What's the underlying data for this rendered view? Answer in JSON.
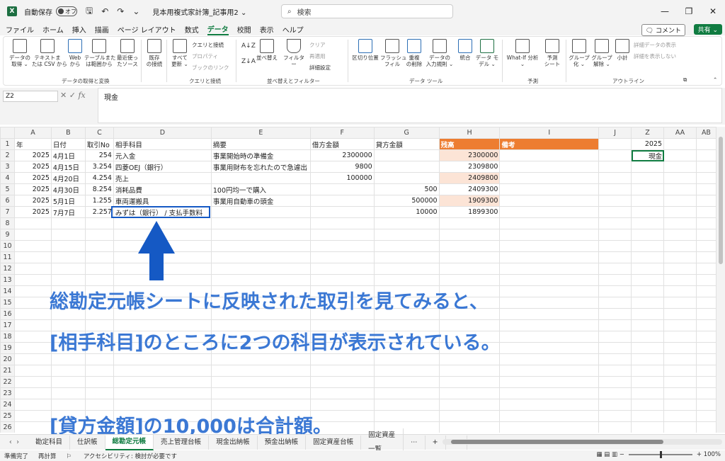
{
  "titlebar": {
    "autosave_label": "自動保存",
    "autosave_state": "オフ",
    "filename": "見本用複式家計簿_記事用2 ⌄",
    "search_placeholder": "検索"
  },
  "menu": {
    "items": [
      "ファイル",
      "ホーム",
      "挿入",
      "描画",
      "ページ レイアウト",
      "数式",
      "データ",
      "校閲",
      "表示",
      "ヘルプ"
    ],
    "active": "データ",
    "comment_label": "コメント",
    "share_label": "共有 ⌄"
  },
  "ribbon": {
    "groups": [
      {
        "name": "データの取得と変換"
      },
      {
        "name": "クエリと接続"
      },
      {
        "name": "並べ替えとフィルター"
      },
      {
        "name": "データ ツール"
      },
      {
        "name": "予測"
      },
      {
        "name": "アウトライン"
      }
    ],
    "buttons": {
      "get_data": "データの\n取得 ⌄",
      "from_text": "テキストま\nたは CSV から",
      "from_web": "Web\nから",
      "from_table": "テーブルまた\nは範囲から",
      "recent": "最近使っ\nたソース",
      "existing": "既存\nの接続",
      "refresh": "すべて\n更新 ⌄",
      "queries": "クエリと接続",
      "properties": "プロパティ",
      "workbook_links": "ブックのリンク",
      "sort": "並べ替え",
      "filter": "フィルター",
      "clear": "クリア",
      "reapply": "再適用",
      "advanced": "詳細設定",
      "text_to_columns": "区切り位置",
      "flash_fill": "フラッシュ\nフィル",
      "remove_dup": "重複\nの削除",
      "validation": "データの\n入力規則 ⌄",
      "consolidate": "統合",
      "data_model": "データ モ\nデル ⌄",
      "whatif": "What-If 分析\n⌄",
      "forecast": "予測\nシート",
      "group": "グループ\n化 ⌄",
      "ungroup": "グループ\n解除 ⌄",
      "subtotal": "小計",
      "show_detail": "詳細データの表示",
      "hide_detail": "詳細を表示しない"
    }
  },
  "formula": {
    "cell_ref": "Z2",
    "content": "現金"
  },
  "sheet": {
    "columns": [
      "",
      "A",
      "B",
      "C",
      "D",
      "E",
      "F",
      "G",
      "H",
      "I",
      "J",
      "Z",
      "AA",
      "AB"
    ],
    "header_row": [
      "年",
      "日付",
      "取引No",
      "相手科目",
      "摘要",
      "借方金額",
      "貸方金額",
      "残高",
      "備考",
      "",
      "2025",
      "",
      ""
    ],
    "rows": [
      [
        "2025",
        "4月1日",
        "254",
        "元入金",
        "事業開始時の準備金",
        "2300000",
        "",
        "2300000",
        "",
        "",
        "現金",
        "",
        ""
      ],
      [
        "2025",
        "4月15日",
        "3.254",
        "四菱OEJ（銀行）",
        "事業用財布を忘れたので急遽出",
        "9800",
        "",
        "2309800",
        "",
        "",
        "",
        "",
        ""
      ],
      [
        "2025",
        "4月20日",
        "4.254",
        "売上",
        "",
        "100000",
        "",
        "2409800",
        "",
        "",
        "",
        "",
        ""
      ],
      [
        "2025",
        "4月30日",
        "8.254",
        "消耗品費",
        "100円均一で購入",
        "",
        "500",
        "2409300",
        "",
        "",
        "",
        "",
        ""
      ],
      [
        "2025",
        "5月1日",
        "1.255",
        "車両運搬具",
        "事業用自動車の頭金",
        "",
        "500000",
        "1909300",
        "",
        "",
        "",
        "",
        ""
      ],
      [
        "2025",
        "7月7日",
        "2.257",
        "みずは（銀行） / 支払手数料",
        "",
        "",
        "10000",
        "1899300",
        "",
        "",
        "",
        "",
        ""
      ]
    ],
    "row_count": 26
  },
  "annotation": {
    "line1": "総勘定元帳シートに反映された取引を見てみると、",
    "line2": "[相手科目]のところに2つの科目が表示されている。",
    "line3": "[貸方金額]の10,000は合計額。",
    "color": "#3b78d4"
  },
  "tabs": {
    "items": [
      "勘定科目",
      "仕訳帳",
      "総勘定元帳",
      "売上管理台帳",
      "現金出納帳",
      "預金出納帳",
      "固定資産台帳",
      "固定資産一覧"
    ],
    "active": "総勘定元帳",
    "more": "⋯"
  },
  "status": {
    "ready": "準備完了",
    "recalc": "再計算",
    "accessibility": "アクセシビリティ: 検討が必要です",
    "zoom": "100%"
  }
}
